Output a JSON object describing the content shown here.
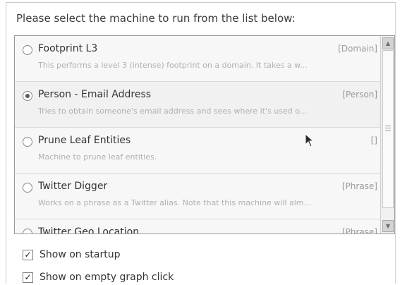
{
  "prompt": "Please select the machine to run from the list below:",
  "machines": [
    {
      "name": "Footprint L3",
      "tag": "[Domain]",
      "description": "This performs a level 3 (intense) footprint on a domain. It takes a w...",
      "selected": false
    },
    {
      "name": "Person - Email Address",
      "tag": "[Person]",
      "description": "Tries to obtain someone's email address and sees where it's used o...",
      "selected": true
    },
    {
      "name": "Prune Leaf Entities",
      "tag": "[]",
      "description": "Machine to prune leaf entities.",
      "selected": false
    },
    {
      "name": "Twitter Digger",
      "tag": "[Phrase]",
      "description": "Works on a phrase as a Twitter alias. Note that this machine will alm...",
      "selected": false
    },
    {
      "name": "Twitter Geo Location",
      "tag": "[Phrase]",
      "description": "",
      "selected": false
    }
  ],
  "options": {
    "show_on_startup": {
      "label": "Show on startup",
      "checked": true
    },
    "show_on_empty_graph_click": {
      "label": "Show on empty graph click",
      "checked": true
    }
  },
  "icons": {
    "scroll_up": "scroll-up-arrow",
    "scroll_down": "scroll-down-arrow",
    "cursor": "mouse-pointer",
    "check": "checkmark"
  }
}
